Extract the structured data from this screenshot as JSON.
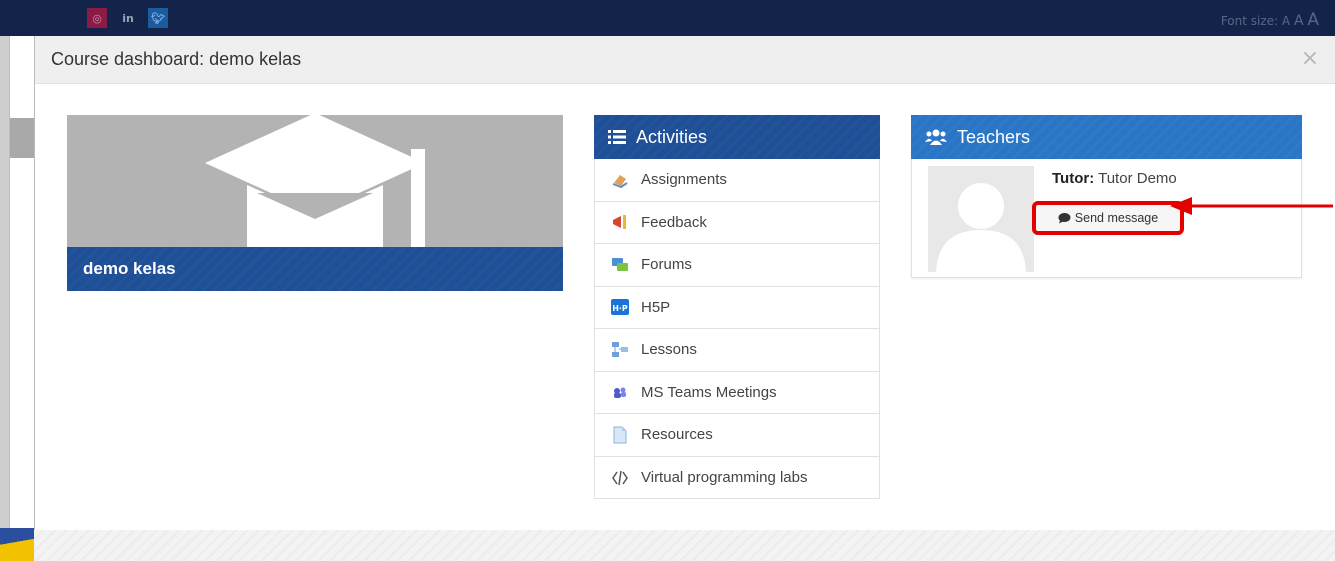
{
  "topbar": {
    "social": [
      "facebook-icon",
      "instagram-icon",
      "linkedin-icon",
      "twitter-icon"
    ],
    "font_size_label": "Font size:",
    "font_size_options": [
      "A",
      "A",
      "A"
    ]
  },
  "modal": {
    "title": "Course dashboard: demo kelas",
    "close_symbol": "×"
  },
  "course": {
    "name": "demo kelas",
    "image": "graduation-cap-icon"
  },
  "activities": {
    "title": "Activities",
    "items": [
      {
        "label": "Assignments",
        "icon": "assignment-icon"
      },
      {
        "label": "Feedback",
        "icon": "megaphone-icon"
      },
      {
        "label": "Forums",
        "icon": "forum-icon"
      },
      {
        "label": "H5P",
        "icon": "h5p-icon"
      },
      {
        "label": "Lessons",
        "icon": "lesson-icon"
      },
      {
        "label": "MS Teams Meetings",
        "icon": "teams-icon"
      },
      {
        "label": "Resources",
        "icon": "file-icon"
      },
      {
        "label": "Virtual programming labs",
        "icon": "vpl-icon"
      }
    ]
  },
  "teachers": {
    "title": "Teachers",
    "role": "Tutor:",
    "name": "Tutor Demo",
    "send_message": "Send message"
  },
  "colors": {
    "primary": "#1f4f95",
    "highlight": "#e30000",
    "topbar": "#13234a"
  }
}
